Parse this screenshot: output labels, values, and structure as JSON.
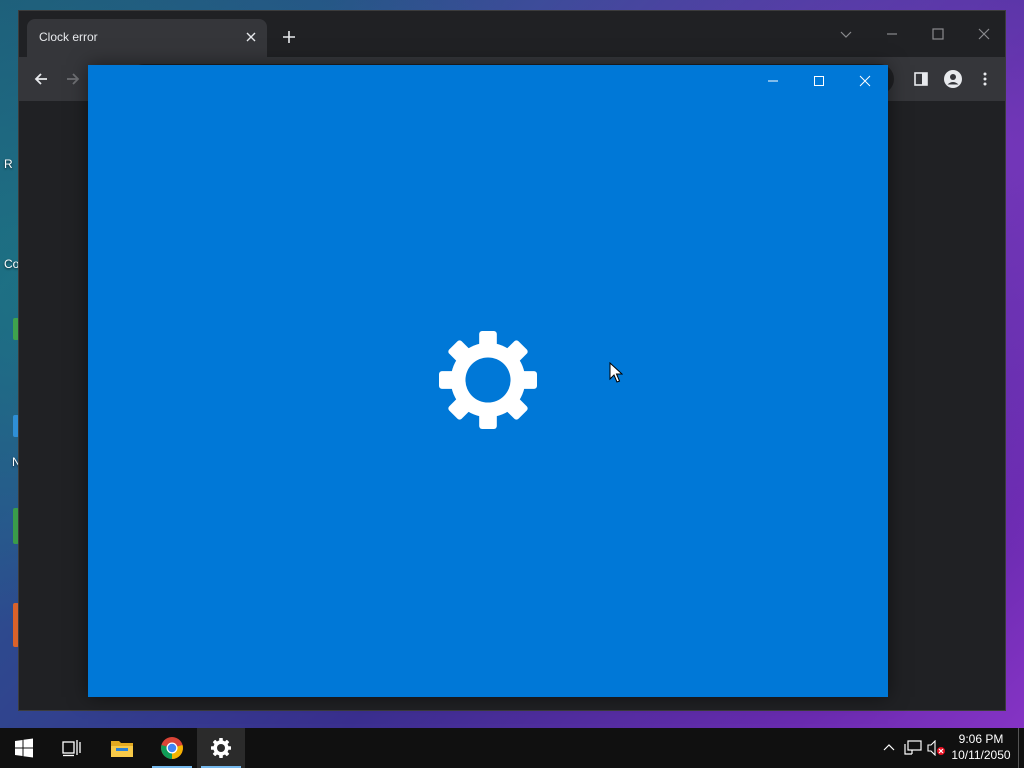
{
  "desktop": {
    "labels": [
      "R",
      "Co",
      "N"
    ]
  },
  "browser": {
    "tab_title": "Clock error",
    "new_tab_icon": "plus-icon",
    "close_tab_icon": "close-icon"
  },
  "settings_app": {
    "background_color": "#0078d7",
    "splash_icon": "gear-icon"
  },
  "taskbar": {
    "items": [
      "start-button",
      "task-view",
      "file-explorer",
      "chrome",
      "settings"
    ],
    "active_item": "settings",
    "time": "9:06 PM",
    "date": "10/11/2050"
  }
}
